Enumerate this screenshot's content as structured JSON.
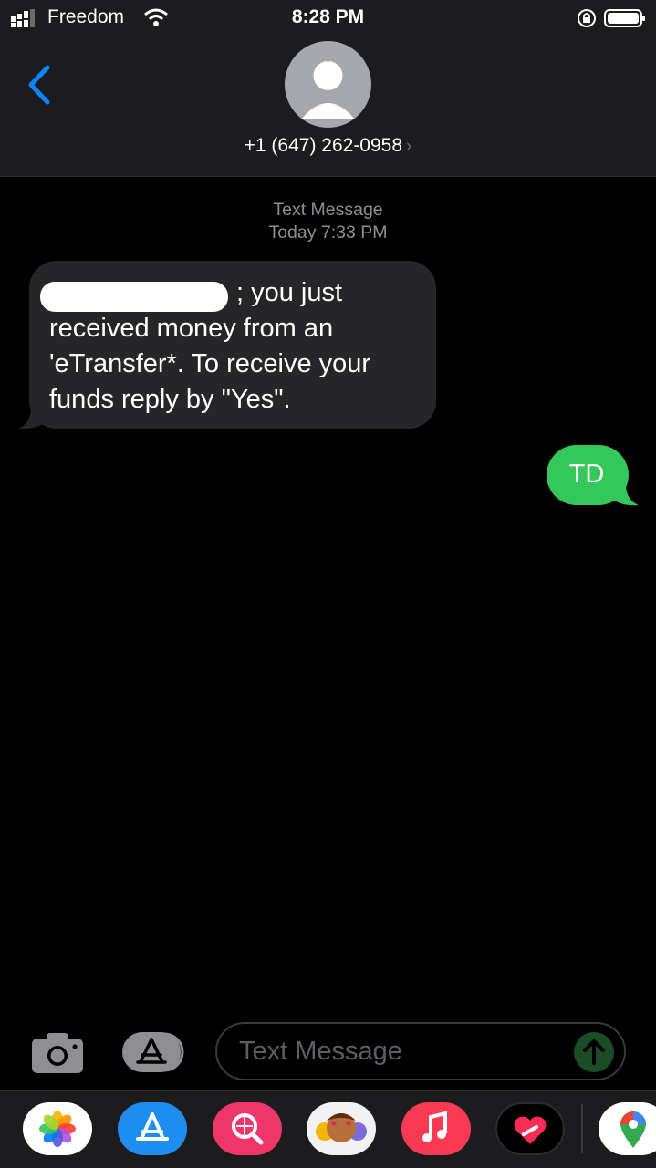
{
  "status_bar": {
    "carrier": "Freedom",
    "time": "8:28 PM"
  },
  "header": {
    "contact": "+1 (647) 262-0958",
    "chevron": "›"
  },
  "conversation": {
    "service": "Text Message",
    "timestamp": "Today 7:33 PM",
    "messages": [
      {
        "direction": "incoming",
        "redacted_prefix": true,
        "text": "; you just received money from an 'eTransfer*. To receive your funds reply by \"Yes\"."
      },
      {
        "direction": "outgoing",
        "text": "TD"
      }
    ]
  },
  "input": {
    "placeholder": "Text Message"
  },
  "dock": {
    "apps": [
      "photos-icon",
      "app-store-icon",
      "web-search-icon",
      "memoji-icon",
      "music-icon",
      "heart-app-icon",
      "maps-icon"
    ]
  },
  "colors": {
    "accent": "#0a84ff",
    "outgoing_bubble": "#34c759",
    "incoming_bubble": "#262628"
  }
}
